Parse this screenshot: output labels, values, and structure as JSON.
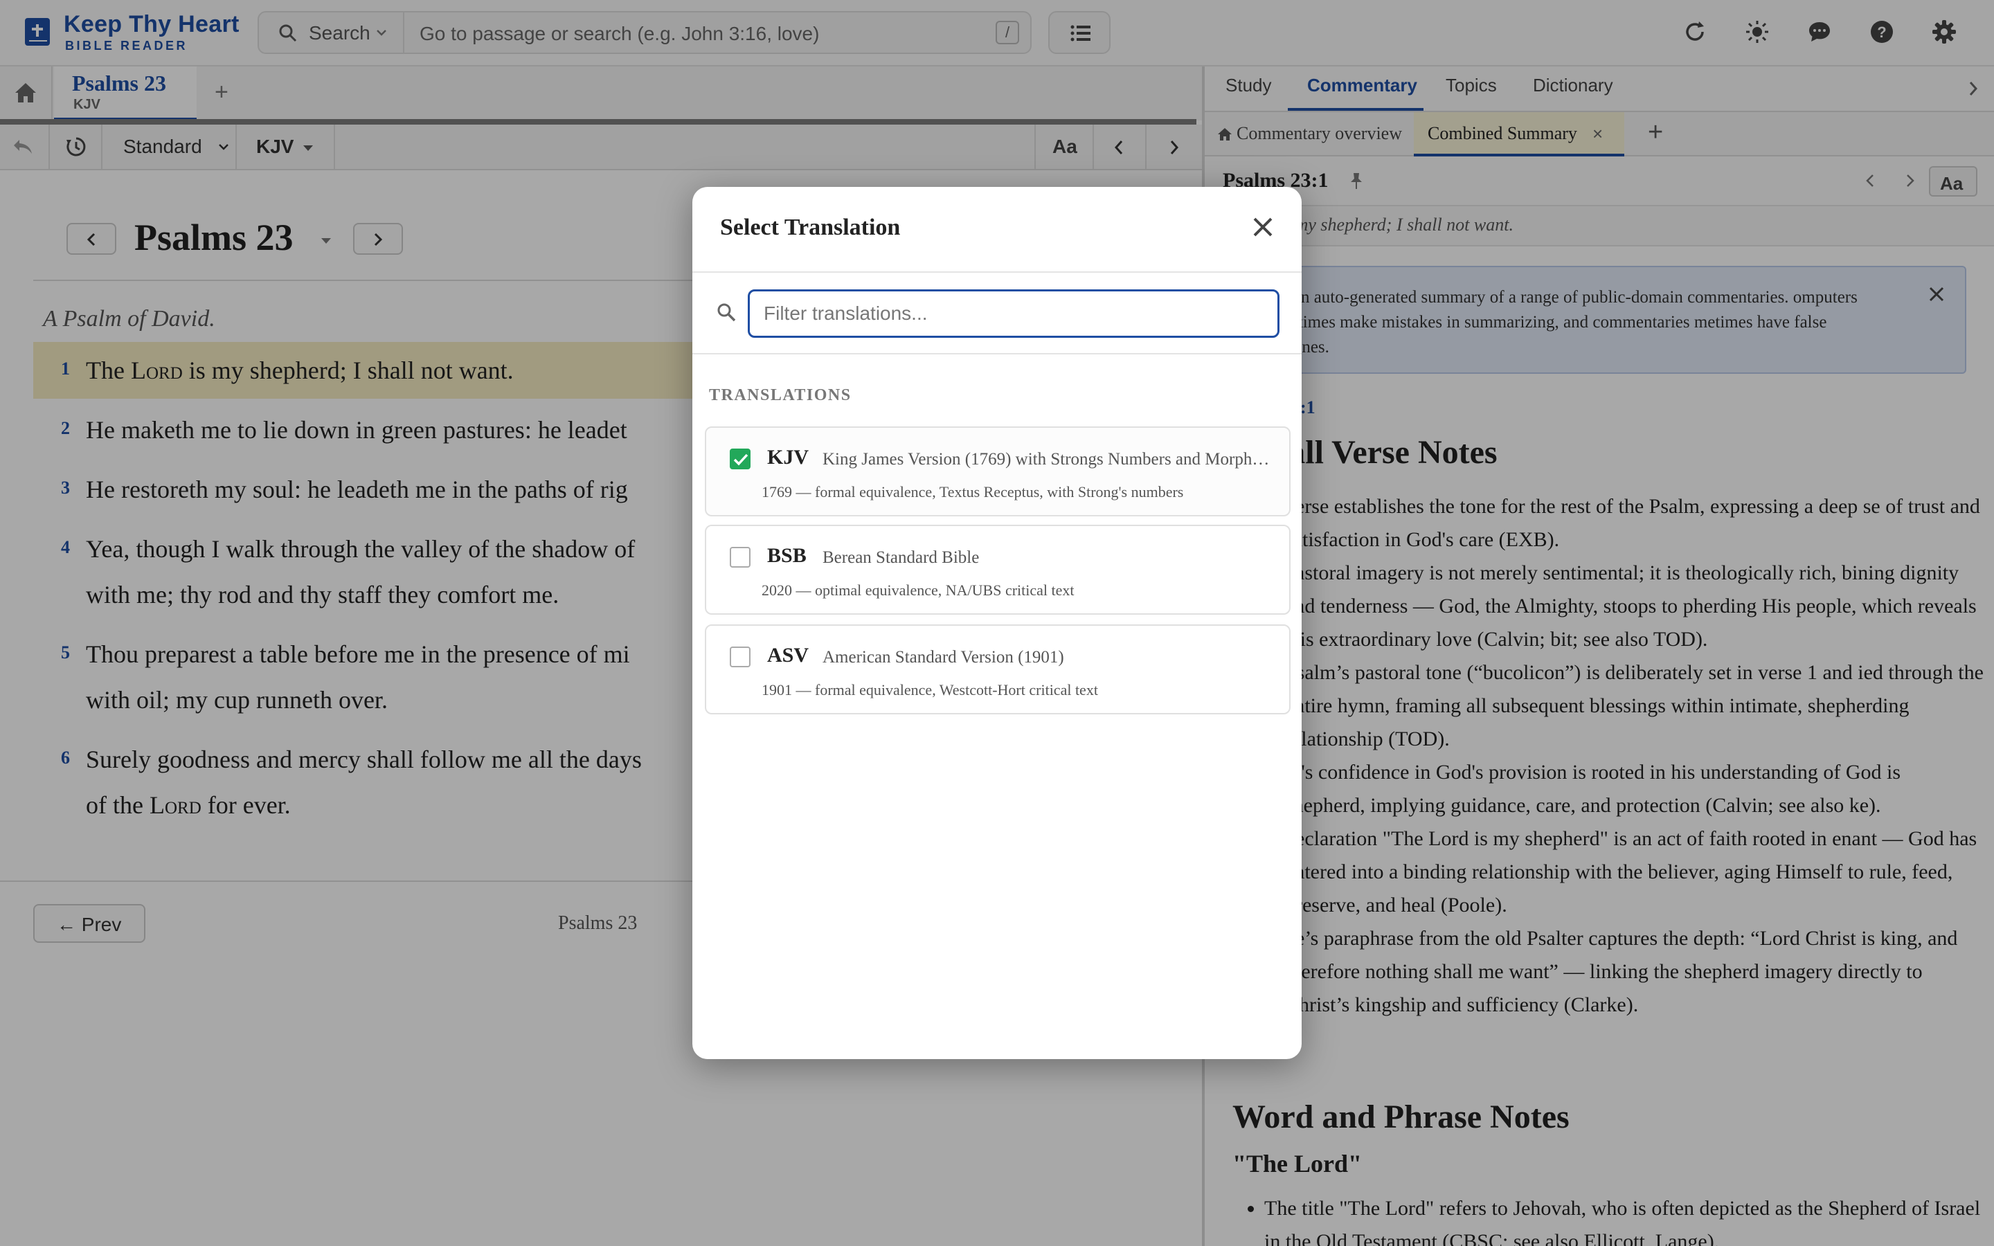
{
  "app": {
    "title": "Keep Thy Heart",
    "subtitle": "BIBLE READER",
    "colors": {
      "accent": "#1f4ea3",
      "highlight": "#f5ecc2",
      "check": "#22a85a"
    }
  },
  "search": {
    "mode_label": "Search",
    "placeholder": "Go to passage or search (e.g. John 3:16, love)",
    "shortcut": "/"
  },
  "toolbar_icons": [
    "list-icon",
    "refresh-icon",
    "brightness-icon",
    "chat-icon",
    "help-icon",
    "settings-icon"
  ],
  "reader": {
    "tab": {
      "title": "Psalms 23",
      "translation": "KJV",
      "add": "+"
    },
    "view_mode": "Standard",
    "translation": "KJV",
    "font_btn": "Aa",
    "chapter_title": "Psalms 23",
    "superscription": "A Psalm of David.",
    "verses": [
      {
        "num": "1",
        "pre": "The ",
        "lord": "Lord",
        "post": " is my shepherd; I shall not want.",
        "cont": ""
      },
      {
        "num": "2",
        "pre": "He maketh me to lie down in green pastures: he leadet",
        "lord": "",
        "post": "",
        "cont": ""
      },
      {
        "num": "3",
        "pre": "He restoreth my soul: he leadeth me in the paths of rig",
        "lord": "",
        "post": "",
        "cont": ""
      },
      {
        "num": "4",
        "pre": "Yea, though I walk through the valley of the shadow of",
        "lord": "",
        "post": "",
        "cont": "with me; thy rod and thy staff they comfort me."
      },
      {
        "num": "5",
        "pre": "Thou preparest a table before me in the presence of mi",
        "lord": "",
        "post": "",
        "cont": "with oil; my cup runneth over."
      },
      {
        "num": "6",
        "pre": "Surely goodness and mercy shall follow me all the days",
        "lord": "",
        "post": "",
        "cont": "of the "
      }
    ],
    "verse6_lord": "Lord",
    "verse6_end": " for ever.",
    "prev_label": "← Prev",
    "footer_chapter": "Psalms 23"
  },
  "right": {
    "tabs": [
      "Study",
      "Commentary",
      "Topics",
      "Dictionary"
    ],
    "subtabs": {
      "overview": "Commentary overview",
      "combined": "Combined Summary",
      "close": "×",
      "add": "+"
    },
    "verse_ref": "Psalms 23:1",
    "font_btn": "Aa",
    "verse_quote": "s my shepherd; I shall not want.",
    "notice": "is is an auto-generated summary of a range of public-domain commentaries. omputers sometimes make mistakes in summarizing, and commentaries metimes have false doctrines.",
    "ref_link": "23:1",
    "overall_heading": "rall Verse Notes",
    "notes": [
      "verse establishes the tone for the rest of the Psalm, expressing a deep se of trust and satisfaction in God's care (EXB).",
      "pastoral imagery is not merely sentimental; it is theologically rich, bining dignity and tenderness — God, the Almighty, stoops to pherding His people, which reveals His extraordinary love (Calvin; bit; see also TOD).",
      "Psalm’s pastoral tone (“bucolicon”) is deliberately set in verse 1 and ied through the entire hymn, framing all subsequent blessings within intimate, shepherding relationship (TOD).",
      "id's confidence in God's provision is rooted in his understanding of God is shepherd, implying guidance, care, and protection (Calvin; see also ke).",
      "declaration \"The Lord is my shepherd\" is an act of faith rooted in enant — God has entered into a binding relationship with the believer, aging Himself to rule, feed, preserve, and heal (Poole).",
      "ke’s paraphrase from the old Psalter captures the depth: “Lord Christ is king, and therefore nothing shall me want” — linking the shepherd imagery directly to Christ’s kingship and sufficiency (Clarke)."
    ],
    "word_heading": "Word and Phrase Notes",
    "phrase_heading": "\"The Lord\"",
    "phrase_notes": [
      "The title \"The Lord\" refers to Jehovah, who is often depicted as the Shepherd of Israel in the Old Testament (CBSC; see also Ellicott, Lange)."
    ]
  },
  "modal": {
    "title": "Select Translation",
    "filter_placeholder": "Filter translations...",
    "section_label": "TRANSLATIONS",
    "translations": [
      {
        "abbr": "KJV",
        "name": "King James Version (1769) with Strongs Numbers and Morphology",
        "desc": "1769 — formal equivalence, Textus Receptus, with Strong's numbers",
        "selected": true
      },
      {
        "abbr": "BSB",
        "name": "Berean Standard Bible",
        "desc": "2020 — optimal equivalence, NA/UBS critical text",
        "selected": false
      },
      {
        "abbr": "ASV",
        "name": "American Standard Version (1901)",
        "desc": "1901 — formal equivalence, Westcott-Hort critical text",
        "selected": false
      }
    ]
  }
}
